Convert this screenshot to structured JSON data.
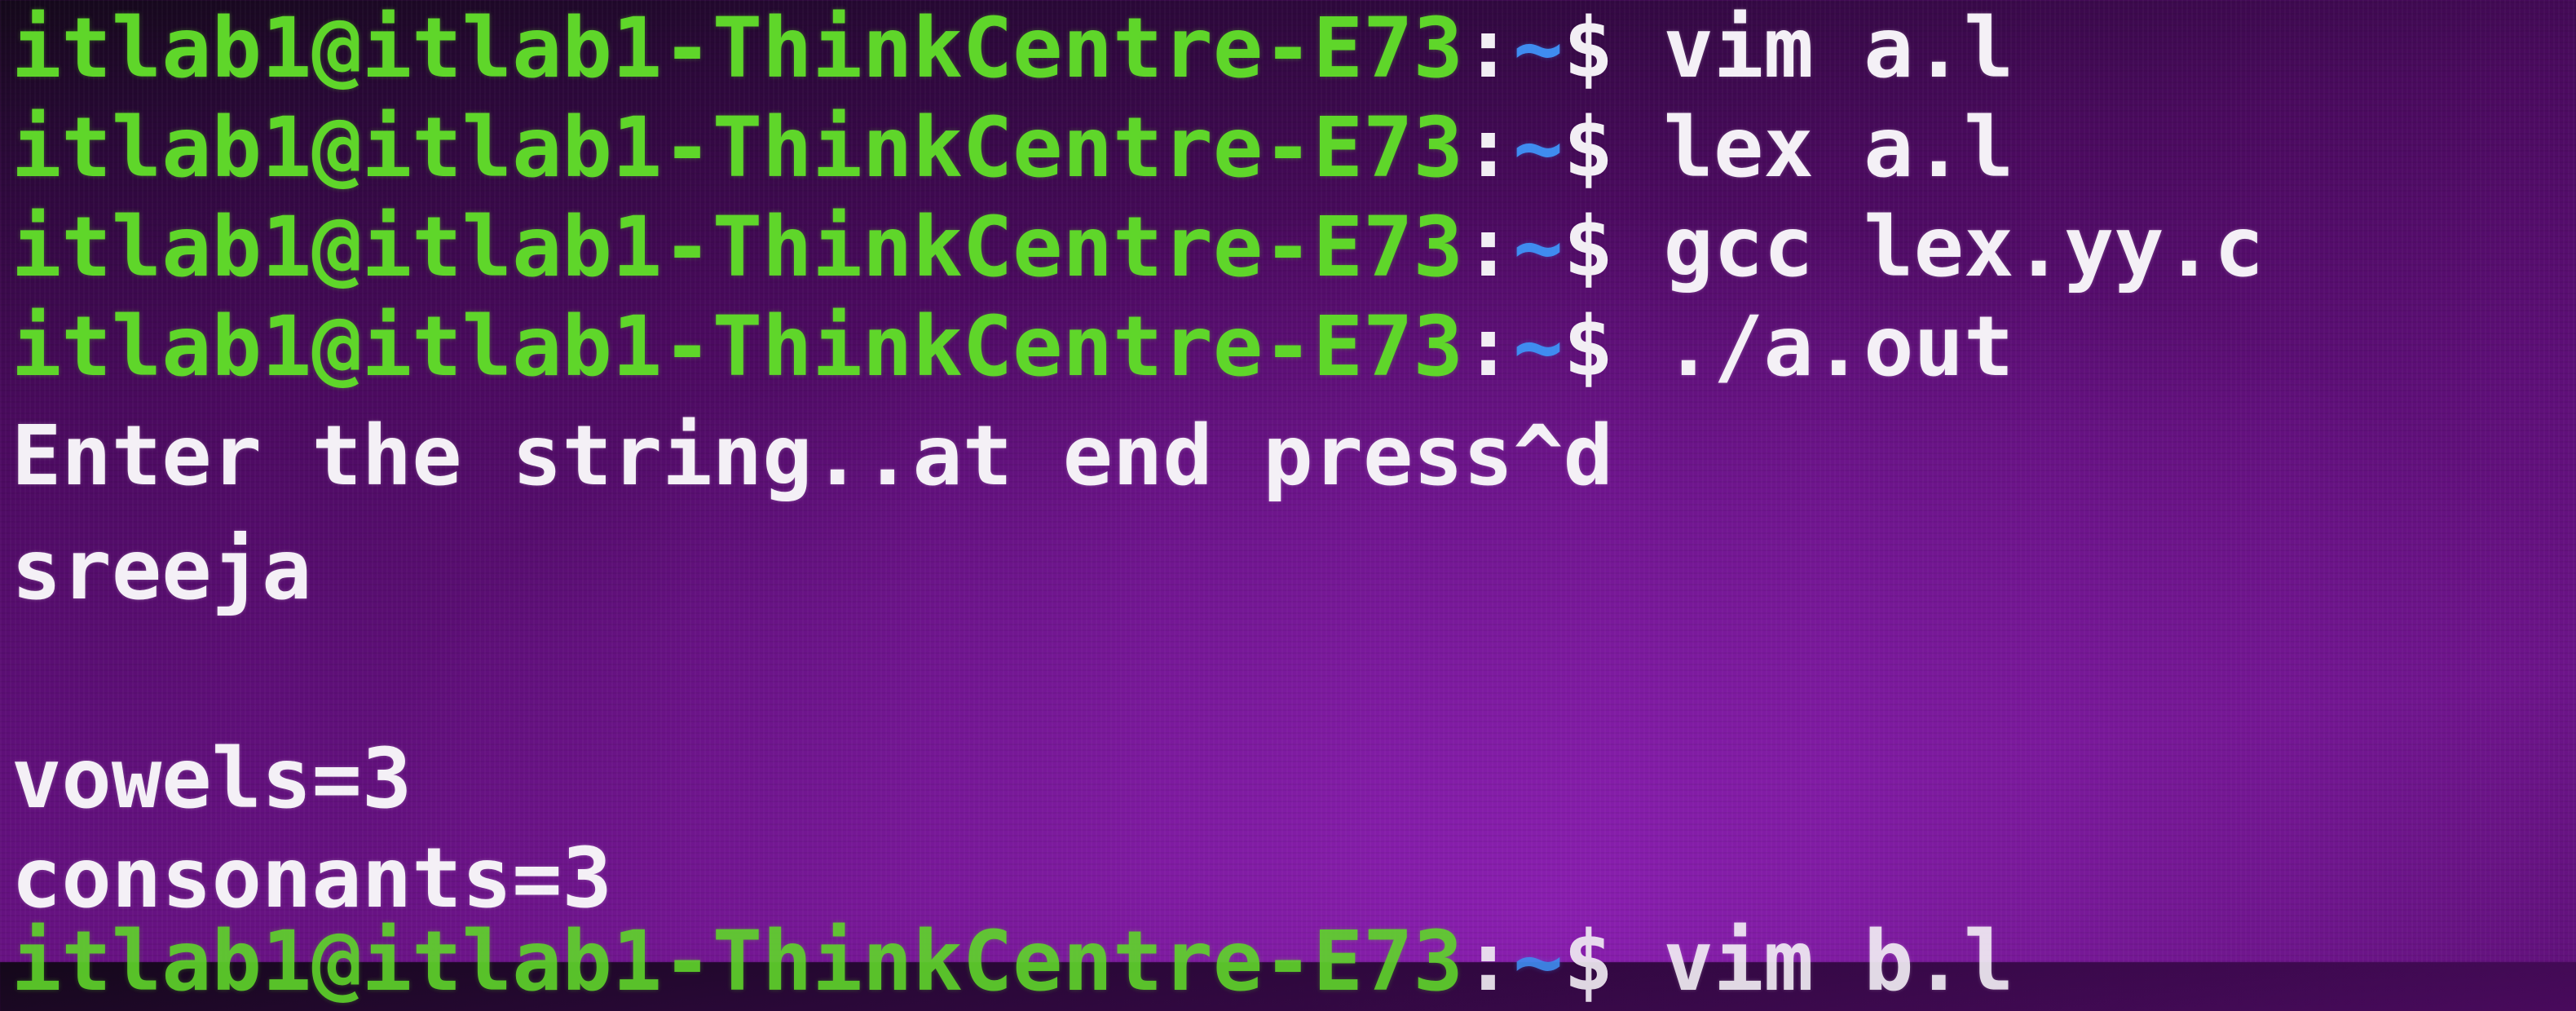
{
  "terminal": {
    "prompt": {
      "user_host": "itlab1@itlab1-ThinkCentre-E73",
      "separator": ":",
      "path": "~",
      "symbol": "$ "
    },
    "commands": [
      "vim a.l",
      "lex a.l",
      "gcc lex.yy.c",
      "./a.out"
    ],
    "output": {
      "instruction": "Enter the string..at end press^d",
      "input_echo": "sreeja",
      "vowels": "vowels=3",
      "consonants": "consonants=3"
    },
    "partial_command": "vim b.l"
  },
  "colors": {
    "prompt_user": "#5fd62a",
    "prompt_path": "#3f8cf0",
    "text": "#f2eef4",
    "background": "#5e0f78"
  }
}
